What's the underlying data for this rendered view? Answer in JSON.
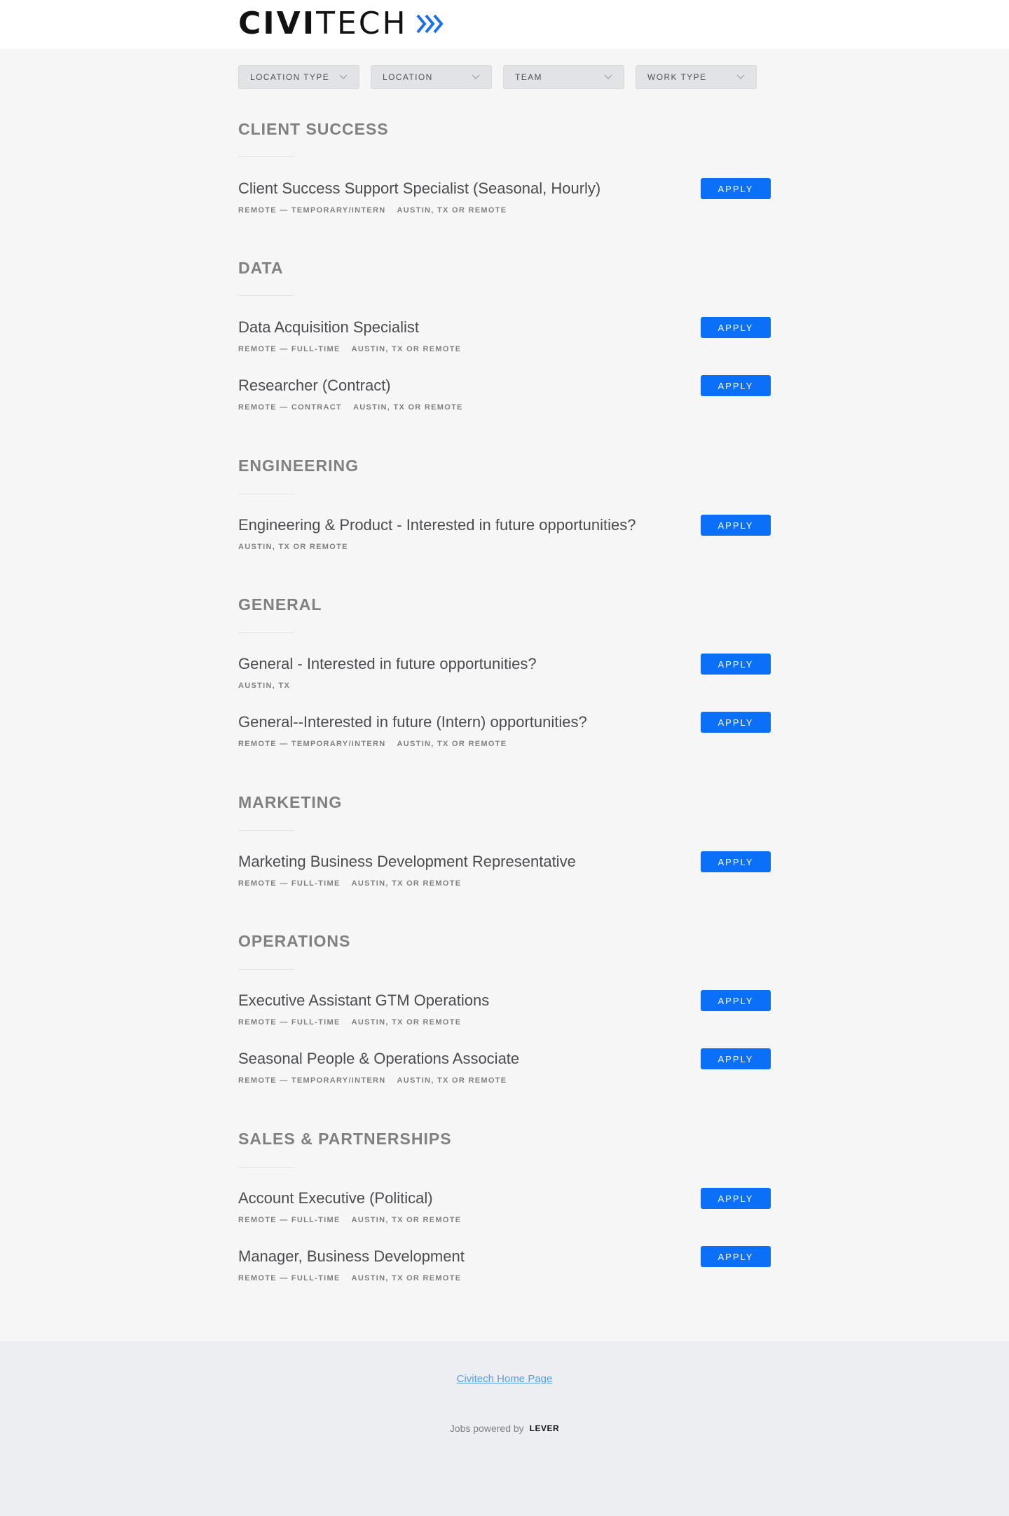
{
  "brand": {
    "logo_bold": "CIVI",
    "logo_regular": "TECH",
    "accent_color": "#1a6ef0"
  },
  "filters": [
    {
      "label": "LOCATION TYPE"
    },
    {
      "label": "LOCATION"
    },
    {
      "label": "TEAM"
    },
    {
      "label": "WORK TYPE"
    }
  ],
  "apply_label": "APPLY",
  "teams": [
    {
      "name": "CLIENT SUCCESS",
      "postings": [
        {
          "title": "Client Success Support Specialist (Seasonal, Hourly)",
          "meta": [
            "REMOTE — TEMPORARY/INTERN",
            "AUSTIN, TX OR REMOTE"
          ]
        }
      ]
    },
    {
      "name": "DATA",
      "postings": [
        {
          "title": "Data Acquisition Specialist",
          "meta": [
            "REMOTE — FULL-TIME",
            "AUSTIN, TX OR REMOTE"
          ]
        },
        {
          "title": "Researcher (Contract)",
          "meta": [
            "REMOTE — CONTRACT",
            "AUSTIN, TX OR REMOTE"
          ]
        }
      ]
    },
    {
      "name": "ENGINEERING",
      "postings": [
        {
          "title": "Engineering & Product - Interested in future opportunities?",
          "meta": [
            "AUSTIN, TX OR REMOTE"
          ]
        }
      ]
    },
    {
      "name": "GENERAL",
      "postings": [
        {
          "title": "General - Interested in future opportunities?",
          "meta": [
            "AUSTIN, TX"
          ]
        },
        {
          "title": "General--Interested in future (Intern) opportunities?",
          "meta": [
            "REMOTE — TEMPORARY/INTERN",
            "AUSTIN, TX OR REMOTE"
          ]
        }
      ]
    },
    {
      "name": "MARKETING",
      "postings": [
        {
          "title": "Marketing Business Development Representative",
          "meta": [
            "REMOTE — FULL-TIME",
            "AUSTIN, TX OR REMOTE"
          ]
        }
      ]
    },
    {
      "name": "OPERATIONS",
      "postings": [
        {
          "title": "Executive Assistant GTM Operations",
          "meta": [
            "REMOTE — FULL-TIME",
            "AUSTIN, TX OR REMOTE"
          ]
        },
        {
          "title": "Seasonal People & Operations Associate",
          "meta": [
            "REMOTE — TEMPORARY/INTERN",
            "AUSTIN, TX OR REMOTE"
          ]
        }
      ]
    },
    {
      "name": "SALES & PARTNERSHIPS",
      "postings": [
        {
          "title": "Account Executive (Political)",
          "meta": [
            "REMOTE — FULL-TIME",
            "AUSTIN, TX OR REMOTE"
          ]
        },
        {
          "title": "Manager, Business Development",
          "meta": [
            "REMOTE — FULL-TIME",
            "AUSTIN, TX OR REMOTE"
          ]
        }
      ]
    }
  ],
  "footer": {
    "home_link": "Civitech Home Page",
    "powered_by": "Jobs powered by",
    "lever": "LEVER"
  }
}
